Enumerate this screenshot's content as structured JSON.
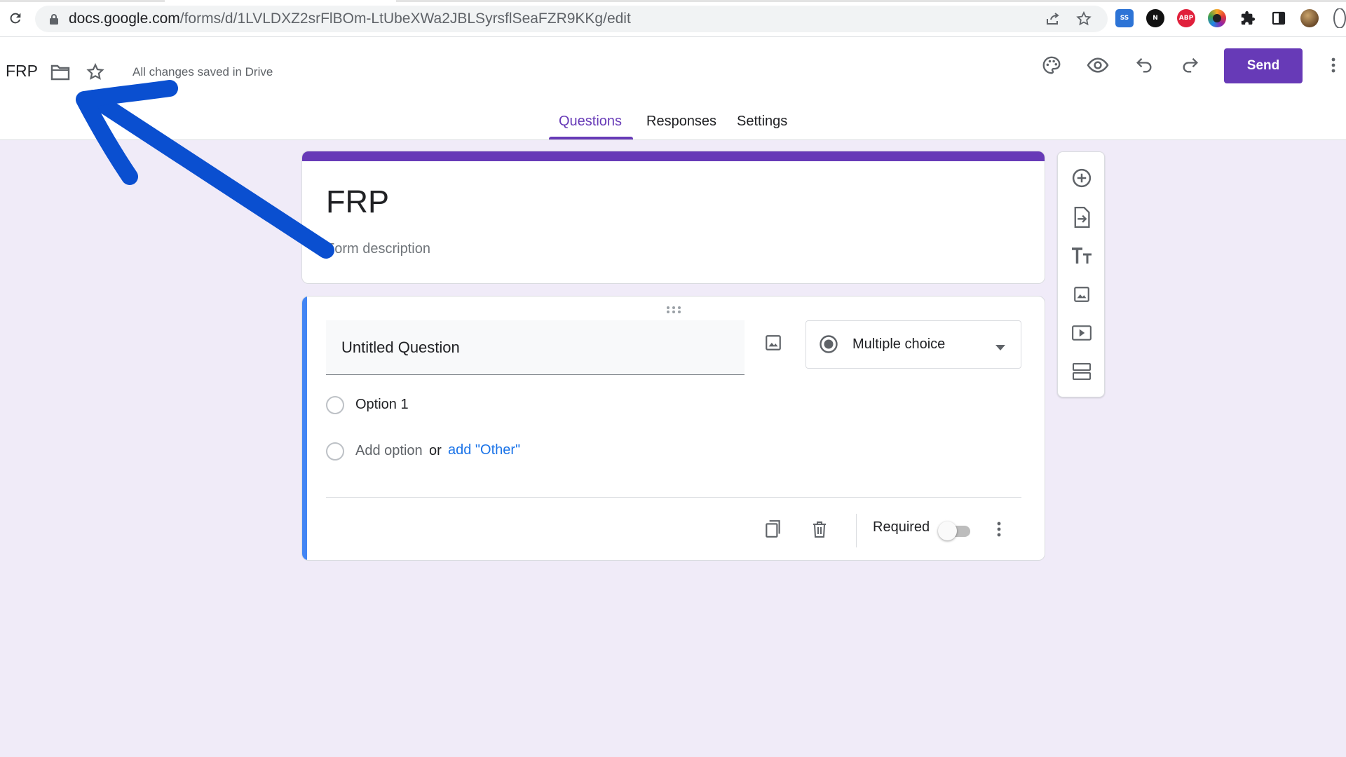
{
  "browser": {
    "url_host": "docs.google.com",
    "url_path": "/forms/d/1LVLDXZ2srFlBOm-LtUbeXWa2JBLSyrsflSeaFZR9KKg/edit",
    "extensions": [
      {
        "name": "screen-capture-extension-icon",
        "color": "#2d74d6",
        "label": "SS"
      },
      {
        "name": "notion-web-clipper-icon",
        "color": "#111111",
        "label": "N"
      },
      {
        "name": "adblock-plus-icon",
        "color": "#e0203b",
        "label": "ABP"
      },
      {
        "name": "color-picker-extension-icon",
        "color": "#c13584",
        "label": ""
      }
    ]
  },
  "header": {
    "doc_title": "FRP",
    "saved_status": "All changes saved in Drive",
    "send_label": "Send",
    "tabs": [
      {
        "label": "Questions",
        "active": true
      },
      {
        "label": "Responses",
        "active": false
      },
      {
        "label": "Settings",
        "active": false
      }
    ]
  },
  "form": {
    "title": "FRP",
    "description_placeholder": "Form description"
  },
  "question": {
    "title": "Untitled Question",
    "type": "Multiple choice",
    "options": [
      "Option 1"
    ],
    "add_option": "Add option",
    "or_text": "or",
    "add_other": "add \"Other\"",
    "required_label": "Required",
    "required": false
  },
  "colors": {
    "accent": "#673ab7",
    "background": "#f0ebf8",
    "question_bar": "#4285f4",
    "link": "#1a73e8",
    "annotation_arrow": "#0a4fd0"
  }
}
